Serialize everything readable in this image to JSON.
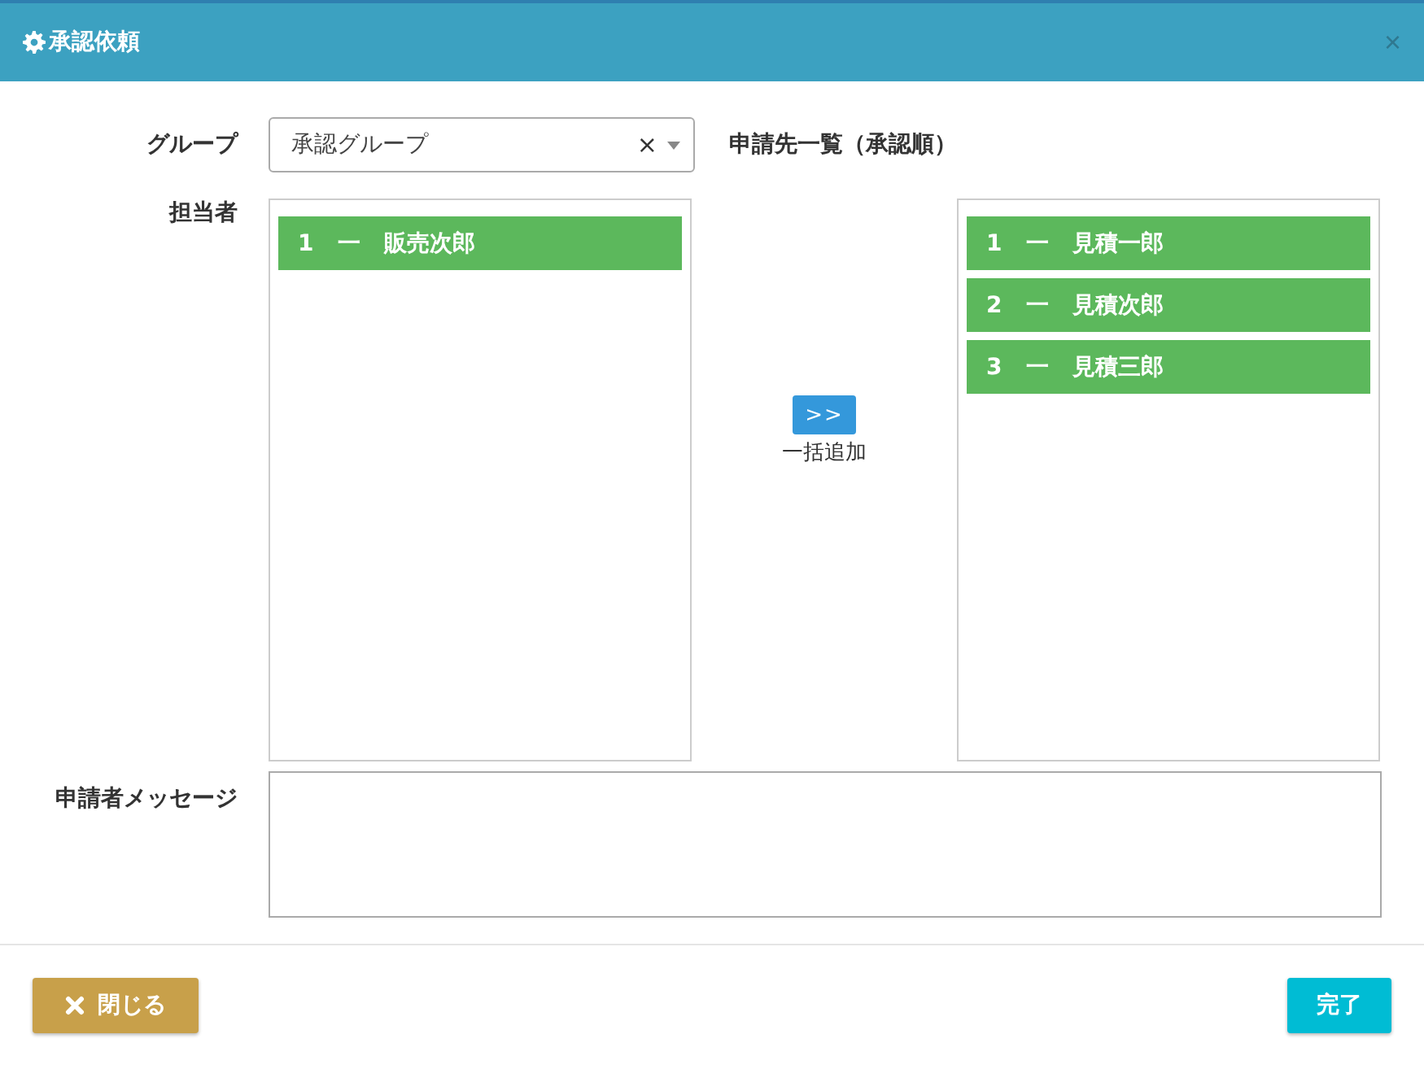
{
  "dialog": {
    "title": "承認依頼",
    "close": "×"
  },
  "group": {
    "label": "グループ",
    "value": "承認グループ",
    "clear": "×"
  },
  "approver_list": {
    "heading": "申請先一覧（承認順）",
    "items": [
      {
        "label": "1   一   見積一郎"
      },
      {
        "label": "2   一   見積次郎"
      },
      {
        "label": "3   一   見積三郎"
      }
    ]
  },
  "assignee": {
    "label": "担当者",
    "items": [
      {
        "label": "1   一   販売次郎"
      }
    ]
  },
  "add_all": {
    "button": ">>",
    "caption": "一括追加"
  },
  "message": {
    "label": "申請者メッセージ"
  },
  "footer": {
    "close": "閉じる",
    "done": "完了"
  }
}
